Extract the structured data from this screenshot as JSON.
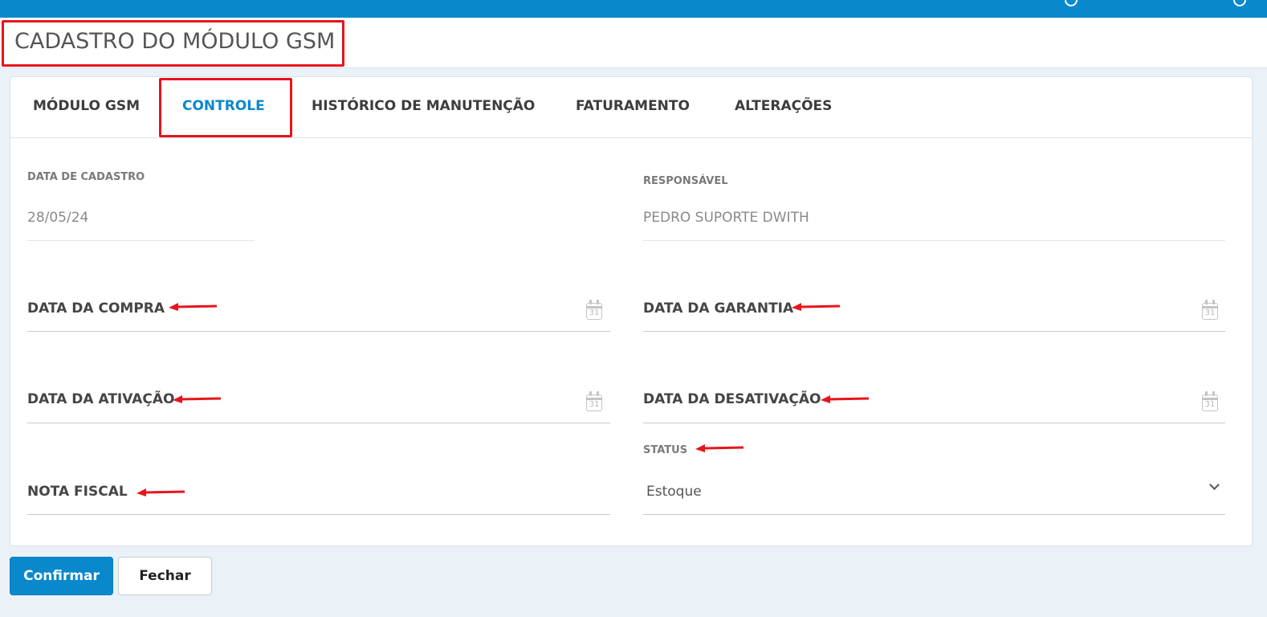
{
  "page": {
    "title": "CADASTRO DO MÓDULO GSM"
  },
  "tabs": [
    {
      "label": "MÓDULO GSM",
      "active": false
    },
    {
      "label": "CONTROLE",
      "active": true
    },
    {
      "label": "HISTÓRICO DE MANUTENÇÃO",
      "active": false
    },
    {
      "label": "FATURAMENTO",
      "active": false
    },
    {
      "label": "ALTERAÇÕES",
      "active": false
    }
  ],
  "form": {
    "data_cadastro": {
      "label": "DATA DE CADASTRO",
      "value": "28/05/24"
    },
    "responsavel": {
      "label": "RESPONSÁVEL",
      "value": "PEDRO SUPORTE DWITH"
    },
    "data_compra": {
      "label": "DATA DA COMPRA",
      "value": ""
    },
    "data_garantia": {
      "label": "DATA DA GARANTIA",
      "value": ""
    },
    "data_ativacao": {
      "label": "DATA DA ATIVAÇÃO",
      "value": ""
    },
    "data_desativacao": {
      "label": "DATA DA DESATIVAÇÃO",
      "value": ""
    },
    "nota_fiscal": {
      "label": "NOTA FISCAL",
      "value": ""
    },
    "status": {
      "label": "STATUS",
      "value": "Estoque"
    },
    "calendar_icon_text": "31"
  },
  "buttons": {
    "confirm": "Confirmar",
    "close": "Fechar"
  },
  "colors": {
    "accent": "#0a88cc",
    "annotation": "#e8141b"
  },
  "icons": {
    "calendar": "calendar-icon",
    "chevron": "chevron-down-icon",
    "arrow": "annotation-arrow"
  }
}
